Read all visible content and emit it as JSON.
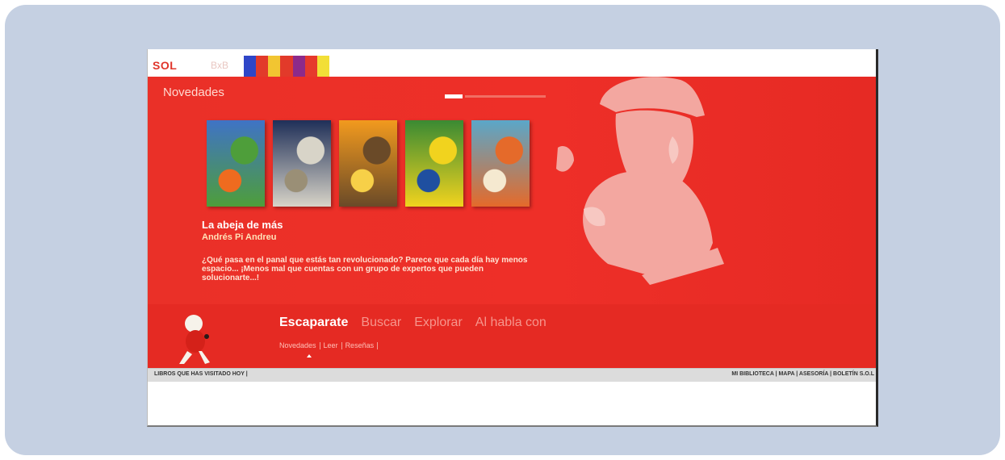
{
  "logo": {
    "primary": "SOL",
    "secondary": "BxB"
  },
  "color_strip": [
    "#2f46c8",
    "#e23a2a",
    "#f2c531",
    "#e23a2a",
    "#8d2a8a",
    "#e6392c",
    "#f2df37"
  ],
  "hero": {
    "section_title": "Novedades",
    "book": {
      "title": "La abeja de más",
      "author": "Andrés Pi Andreu",
      "description": "¿Qué pasa en el panal que estás tan revolucionado? Parece que cada día hay menos espacio... ¡Menos mal que cuentas con un grupo de expertos que pueden solucionarte...!"
    },
    "covers": [
      {
        "icon": "book-cover-blue-flowers",
        "colors": [
          "#3f73c6",
          "#4e9e3a",
          "#ef6b1f"
        ]
      },
      {
        "icon": "book-cover-abeja",
        "colors": [
          "#1f2f58",
          "#d8d4c8",
          "#9a8f76"
        ]
      },
      {
        "icon": "book-cover-orange-characters",
        "colors": [
          "#f29a1e",
          "#6a4a28",
          "#f7d048"
        ]
      },
      {
        "icon": "book-cover-green-comic",
        "colors": [
          "#3a8a33",
          "#f1d31e",
          "#1f4fa0"
        ]
      },
      {
        "icon": "book-cover-fox-illustration",
        "colors": [
          "#5aa7c9",
          "#e56a2a",
          "#f5e9d0"
        ]
      }
    ]
  },
  "nav": {
    "items": [
      {
        "label": "Escaparate",
        "active": true
      },
      {
        "label": "Buscar",
        "active": false
      },
      {
        "label": "Explorar",
        "active": false
      },
      {
        "label": "Al habla con",
        "active": false
      }
    ],
    "sub_items": [
      "Novedades",
      "Leer",
      "Reseñas"
    ]
  },
  "status": {
    "visited": "LIBROS QUE HAS VISITADO HOY |",
    "links": "MI BIBLIOTECA | MAPA | ASESORÍA | BOLETÍN S.O.L"
  }
}
